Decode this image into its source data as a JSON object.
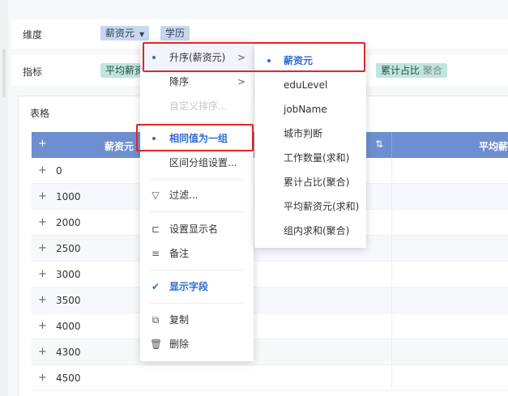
{
  "dimension_row": {
    "label": "维度",
    "chips": [
      {
        "label": "薪资元",
        "caret": "▼"
      },
      {
        "label": "学历"
      }
    ]
  },
  "indicator_row": {
    "label": "指标",
    "chips": [
      {
        "label": "平均薪资"
      },
      {
        "label": "累计占比",
        "sub": "聚合"
      }
    ]
  },
  "table": {
    "title": "表格",
    "header": {
      "plus": "+",
      "col1": "薪资元",
      "sort_icon": "⇅",
      "col2": "平均薪"
    },
    "rows": [
      {
        "plus": "+",
        "value": "0"
      },
      {
        "plus": "+",
        "value": "1000"
      },
      {
        "plus": "+",
        "value": "2000"
      },
      {
        "plus": "+",
        "value": "2500"
      },
      {
        "plus": "+",
        "value": "3000"
      },
      {
        "plus": "+",
        "value": "3500"
      },
      {
        "plus": "+",
        "value": "4000"
      },
      {
        "plus": "+",
        "value": "4300"
      },
      {
        "plus": "+",
        "value": "4500"
      }
    ]
  },
  "context_menu": {
    "items": {
      "sort_asc": "升序(薪资元)",
      "sort_desc": "降序",
      "custom_sort": "自定义排序...",
      "same_group": "相同值为一组",
      "range_group": "区间分组设置...",
      "filter": "过滤...",
      "display_name": "设置显示名",
      "note": "备注",
      "show_field": "显示字段",
      "copy": "复制",
      "delete": "删除"
    },
    "icons": {
      "filter": "▽",
      "display_name": "⊏",
      "note": "≡",
      "show_field": "✔",
      "copy": "⧉",
      "delete": "🗑"
    },
    "arrow": ">"
  },
  "submenu": {
    "items": [
      "薪资元",
      "eduLevel",
      "jobName",
      "城市判断",
      "工作数量(求和)",
      "累计占比(聚合)",
      "平均薪资元(求和)",
      "组内求和(聚合)"
    ],
    "selected_index": 0
  },
  "colors": {
    "accent": "#2f6bd1",
    "highlight_border": "#e0262a",
    "header_bg": "#6d8fd0",
    "chip_blue": "#c8d6ee",
    "chip_teal": "#bfe6dc"
  }
}
